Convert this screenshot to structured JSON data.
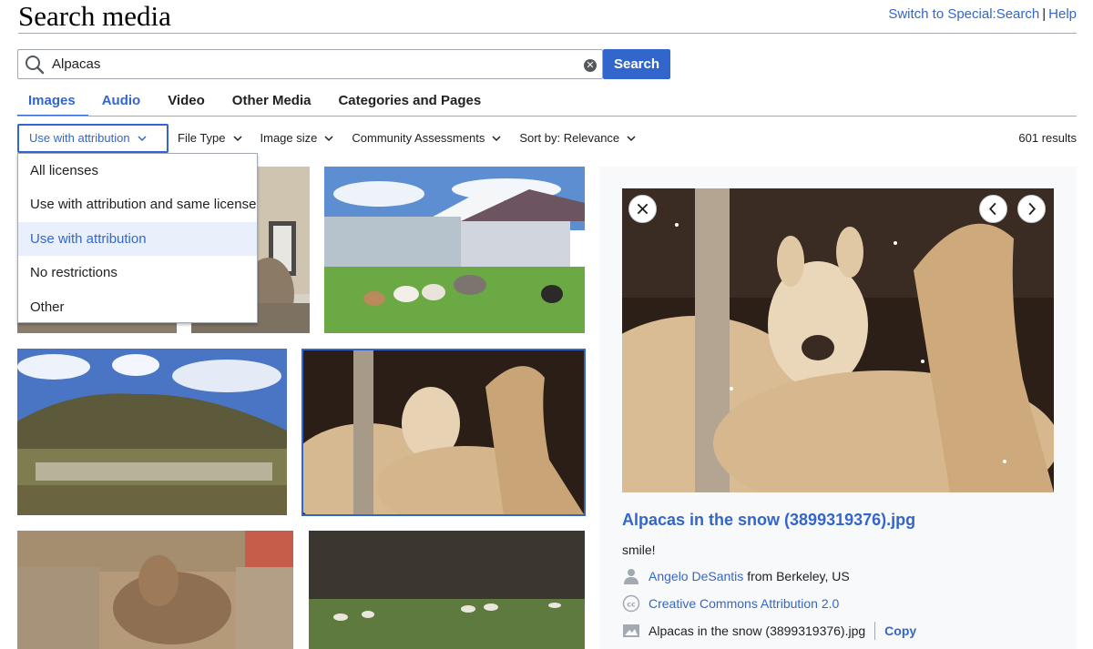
{
  "page": {
    "title": "Search media",
    "top_links": {
      "switch_label": "Switch to Special:Search",
      "separator": "|",
      "help_label": "Help"
    }
  },
  "search": {
    "query": "Alpacas",
    "button_label": "Search"
  },
  "tabs": [
    {
      "label": "Images",
      "active": true
    },
    {
      "label": "Audio"
    },
    {
      "label": "Video"
    },
    {
      "label": "Other Media"
    },
    {
      "label": "Categories and Pages"
    }
  ],
  "filters": {
    "license": "Use with attribution",
    "file_type": "File Type",
    "image_size": "Image size",
    "community": "Community Assessments",
    "sort": "Sort by: Relevance"
  },
  "results_count": "601 results",
  "license_menu": {
    "options": [
      "All licenses",
      "Use with attribution and same license",
      "Use with attribution",
      "No restrictions",
      "Other"
    ],
    "selected": "Use with attribution"
  },
  "detail": {
    "title": "Alpacas in the snow (3899319376).jpg",
    "description": "smile!",
    "author_name": "Angelo DeSantis",
    "author_from": "from Berkeley, US",
    "license": "Creative Commons Attribution 2.0",
    "filename": "Alpacas in the snow (3899319376).jpg",
    "copy_label": "Copy"
  },
  "colors": {
    "accent": "#3366cc",
    "selected_bg": "#eaf0fb",
    "panel_bg": "#f8f9fa",
    "border": "#a2a9b1"
  },
  "icons": {
    "search": "magnifier-icon",
    "clear": "clear-circle-icon",
    "chevron": "chevron-down-icon",
    "close": "close-icon",
    "prev": "chevron-left-icon",
    "next": "chevron-right-icon",
    "user": "user-icon",
    "license": "cc-icon",
    "image": "image-icon"
  }
}
